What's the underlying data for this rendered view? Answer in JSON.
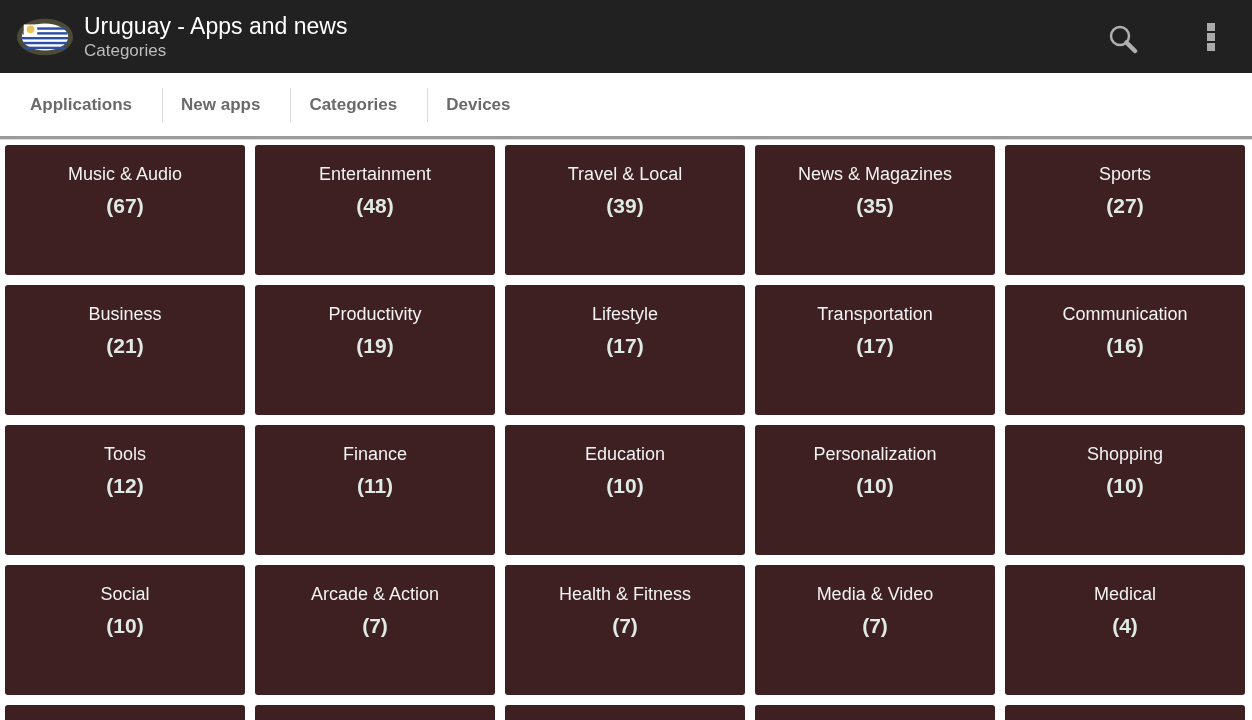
{
  "app_bar": {
    "title": "Uruguay - Apps and news",
    "subtitle": "Categories"
  },
  "tabs": [
    {
      "label": "Applications"
    },
    {
      "label": "New apps"
    },
    {
      "label": "Categories"
    },
    {
      "label": "Devices"
    }
  ],
  "categories": [
    {
      "name": "Music & Audio",
      "count": "(67)"
    },
    {
      "name": "Entertainment",
      "count": "(48)"
    },
    {
      "name": "Travel & Local",
      "count": "(39)"
    },
    {
      "name": "News & Magazines",
      "count": "(35)"
    },
    {
      "name": "Sports",
      "count": "(27)"
    },
    {
      "name": "Business",
      "count": "(21)"
    },
    {
      "name": "Productivity",
      "count": "(19)"
    },
    {
      "name": "Lifestyle",
      "count": "(17)"
    },
    {
      "name": "Transportation",
      "count": "(17)"
    },
    {
      "name": "Communication",
      "count": "(16)"
    },
    {
      "name": "Tools",
      "count": "(12)"
    },
    {
      "name": "Finance",
      "count": "(11)"
    },
    {
      "name": "Education",
      "count": "(10)"
    },
    {
      "name": "Personalization",
      "count": "(10)"
    },
    {
      "name": "Shopping",
      "count": "(10)"
    },
    {
      "name": "Social",
      "count": "(10)"
    },
    {
      "name": "Arcade & Action",
      "count": "(7)"
    },
    {
      "name": "Health & Fitness",
      "count": "(7)"
    },
    {
      "name": "Media & Video",
      "count": "(7)"
    },
    {
      "name": "Medical",
      "count": "(4)"
    }
  ]
}
